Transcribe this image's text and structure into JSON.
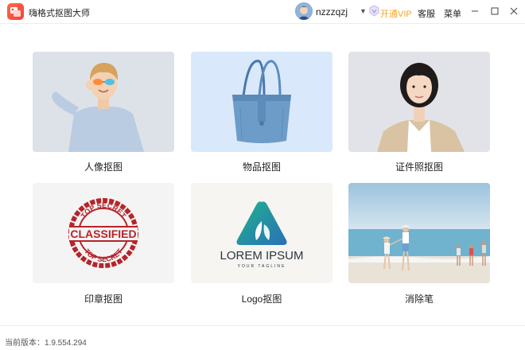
{
  "app": {
    "title": "嗨格式抠图大师",
    "username": "nzzzqzj",
    "open_vip": "开通VIP",
    "customer_service": "客服",
    "menu": "菜单",
    "icons": {
      "logo": "app-logo-icon",
      "avatar": "avatar",
      "dropdown": "chevron-down-icon",
      "vip": "vip-badge-icon",
      "minimize": "minimize-icon",
      "maximize": "maximize-icon",
      "close": "close-icon"
    },
    "colors": {
      "accent": "#f5a623",
      "logo": "#f0413a"
    }
  },
  "cards": [
    {
      "label": "人像抠图"
    },
    {
      "label": "物品抠图"
    },
    {
      "label": "证件照抠图"
    },
    {
      "label": "印章抠图",
      "image_text": {
        "top": "TOP SECRET",
        "middle": "CLASSIFIED",
        "bottom": "TOP SECRET"
      }
    },
    {
      "label": "Logo抠图",
      "image_text": {
        "name": "LOREM IPSUM",
        "tagline": "YOUR TAGLINE"
      }
    },
    {
      "label": "消除笔"
    }
  ],
  "footer": {
    "version": "当前版本：1.9.554.294"
  }
}
